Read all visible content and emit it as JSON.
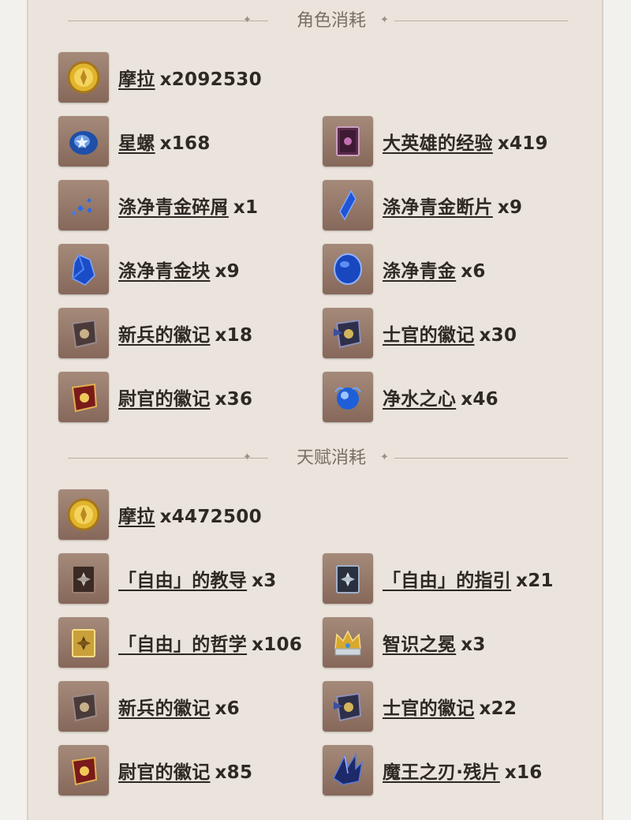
{
  "sections": [
    {
      "title": "角色消耗",
      "items": [
        {
          "name": "摩拉",
          "qty": "x2092530",
          "icon": "mora-icon"
        },
        {
          "name": "星螺",
          "qty": "x168",
          "icon": "starconch-icon"
        },
        {
          "name": "大英雄的经验",
          "qty": "x419",
          "icon": "heros-wit-icon"
        },
        {
          "name": "涤净青金碎屑",
          "qty": "x1",
          "icon": "lapis-sliver-icon"
        },
        {
          "name": "涤净青金断片",
          "qty": "x9",
          "icon": "lapis-fragment-icon"
        },
        {
          "name": "涤净青金块",
          "qty": "x9",
          "icon": "lapis-chunk-icon"
        },
        {
          "name": "涤净青金",
          "qty": "x6",
          "icon": "lapis-gemstone-icon"
        },
        {
          "name": "新兵的徽记",
          "qty": "x18",
          "icon": "recruit-insignia-icon"
        },
        {
          "name": "士官的徽记",
          "qty": "x30",
          "icon": "sergeant-insignia-icon"
        },
        {
          "name": "尉官的徽记",
          "qty": "x36",
          "icon": "lieutenant-insignia-icon"
        },
        {
          "name": "净水之心",
          "qty": "x46",
          "icon": "cleansing-heart-icon"
        }
      ]
    },
    {
      "title": "天赋消耗",
      "items": [
        {
          "name": "摩拉",
          "qty": "x4472500",
          "icon": "mora-icon"
        },
        {
          "name": "「自由」的教导",
          "qty": "x3",
          "icon": "teachings-freedom-icon"
        },
        {
          "name": "「自由」的指引",
          "qty": "x21",
          "icon": "guide-freedom-icon"
        },
        {
          "name": "「自由」的哲学",
          "qty": "x106",
          "icon": "philosophies-freedom-icon"
        },
        {
          "name": "智识之冕",
          "qty": "x3",
          "icon": "crown-insight-icon"
        },
        {
          "name": "新兵的徽记",
          "qty": "x6",
          "icon": "recruit-insignia-icon"
        },
        {
          "name": "士官的徽记",
          "qty": "x22",
          "icon": "sergeant-insignia-icon"
        },
        {
          "name": "尉官的徽记",
          "qty": "x85",
          "icon": "lieutenant-insignia-icon"
        },
        {
          "name": "魔王之刃·残片",
          "qty": "x16",
          "icon": "tyrants-fang-icon"
        }
      ]
    }
  ]
}
